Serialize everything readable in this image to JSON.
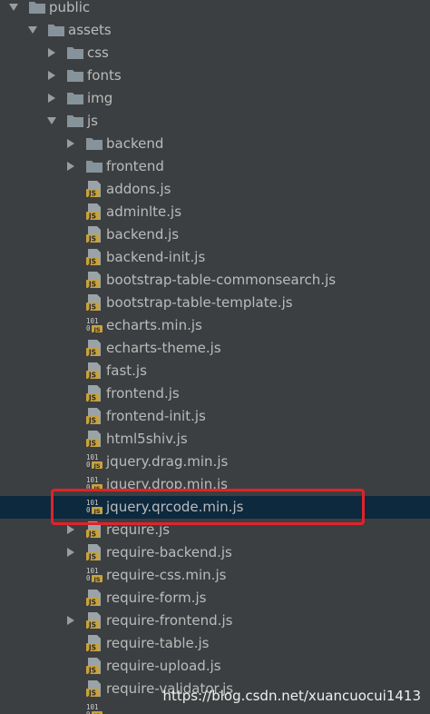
{
  "tree": {
    "items": [
      {
        "label": "public",
        "kind": "folder",
        "state": "expanded",
        "depth": 0,
        "icon": "folder-icon"
      },
      {
        "label": "assets",
        "kind": "folder",
        "state": "expanded",
        "depth": 1,
        "icon": "folder-icon"
      },
      {
        "label": "css",
        "kind": "folder",
        "state": "collapsed",
        "depth": 2,
        "icon": "folder-icon"
      },
      {
        "label": "fonts",
        "kind": "folder",
        "state": "collapsed",
        "depth": 2,
        "icon": "folder-icon"
      },
      {
        "label": "img",
        "kind": "folder",
        "state": "collapsed",
        "depth": 2,
        "icon": "folder-icon"
      },
      {
        "label": "js",
        "kind": "folder",
        "state": "expanded",
        "depth": 2,
        "icon": "folder-icon"
      },
      {
        "label": "backend",
        "kind": "folder",
        "state": "collapsed",
        "depth": 3,
        "icon": "folder-icon"
      },
      {
        "label": "frontend",
        "kind": "folder",
        "state": "collapsed",
        "depth": 3,
        "icon": "folder-icon"
      },
      {
        "label": "addons.js",
        "kind": "file",
        "depth": 3,
        "icon": "js-file-icon"
      },
      {
        "label": "adminlte.js",
        "kind": "file",
        "depth": 3,
        "icon": "js-file-icon"
      },
      {
        "label": "backend.js",
        "kind": "file",
        "depth": 3,
        "icon": "js-file-icon"
      },
      {
        "label": "backend-init.js",
        "kind": "file",
        "depth": 3,
        "icon": "js-file-icon"
      },
      {
        "label": "bootstrap-table-commonsearch.js",
        "kind": "file",
        "depth": 3,
        "icon": "js-file-icon"
      },
      {
        "label": "bootstrap-table-template.js",
        "kind": "file",
        "depth": 3,
        "icon": "js-file-icon"
      },
      {
        "label": "echarts.min.js",
        "kind": "file",
        "depth": 3,
        "icon": "minified-js-file-icon"
      },
      {
        "label": "echarts-theme.js",
        "kind": "file",
        "depth": 3,
        "icon": "js-file-icon"
      },
      {
        "label": "fast.js",
        "kind": "file",
        "depth": 3,
        "icon": "js-file-icon"
      },
      {
        "label": "frontend.js",
        "kind": "file",
        "depth": 3,
        "icon": "js-file-icon"
      },
      {
        "label": "frontend-init.js",
        "kind": "file",
        "depth": 3,
        "icon": "js-file-icon"
      },
      {
        "label": "html5shiv.js",
        "kind": "file",
        "depth": 3,
        "icon": "js-file-icon"
      },
      {
        "label": "jquery.drag.min.js",
        "kind": "file",
        "depth": 3,
        "icon": "minified-js-file-icon"
      },
      {
        "label": "jquery.drop.min.js",
        "kind": "file",
        "depth": 3,
        "icon": "minified-js-file-icon"
      },
      {
        "label": "jquery.qrcode.min.js",
        "kind": "file",
        "depth": 3,
        "icon": "minified-js-file-icon",
        "selected": true,
        "highlighted": true
      },
      {
        "label": "require.js",
        "kind": "file",
        "depth": 3,
        "icon": "js-file-icon",
        "state": "collapsed"
      },
      {
        "label": "require-backend.js",
        "kind": "file",
        "depth": 3,
        "icon": "js-file-icon",
        "state": "collapsed"
      },
      {
        "label": "require-css.min.js",
        "kind": "file",
        "depth": 3,
        "icon": "minified-js-file-icon"
      },
      {
        "label": "require-form.js",
        "kind": "file",
        "depth": 3,
        "icon": "js-file-icon"
      },
      {
        "label": "require-frontend.js",
        "kind": "file",
        "depth": 3,
        "icon": "js-file-icon",
        "state": "collapsed"
      },
      {
        "label": "require-table.js",
        "kind": "file",
        "depth": 3,
        "icon": "js-file-icon"
      },
      {
        "label": "require-upload.js",
        "kind": "file",
        "depth": 3,
        "icon": "js-file-icon"
      },
      {
        "label": "require-validator.js",
        "kind": "file",
        "depth": 3,
        "icon": "js-file-icon"
      },
      {
        "label": "",
        "kind": "file",
        "depth": 3,
        "icon": "minified-js-file-icon"
      }
    ]
  },
  "watermark": "https://blog.csdn.net/xuancuocui1413",
  "colors": {
    "background": "#3c3f41",
    "text": "#bbbbbb",
    "selection": "#0d293e",
    "highlight_border": "#e0232a",
    "folder": "#87939a",
    "js_badge": "#c8a23c"
  }
}
